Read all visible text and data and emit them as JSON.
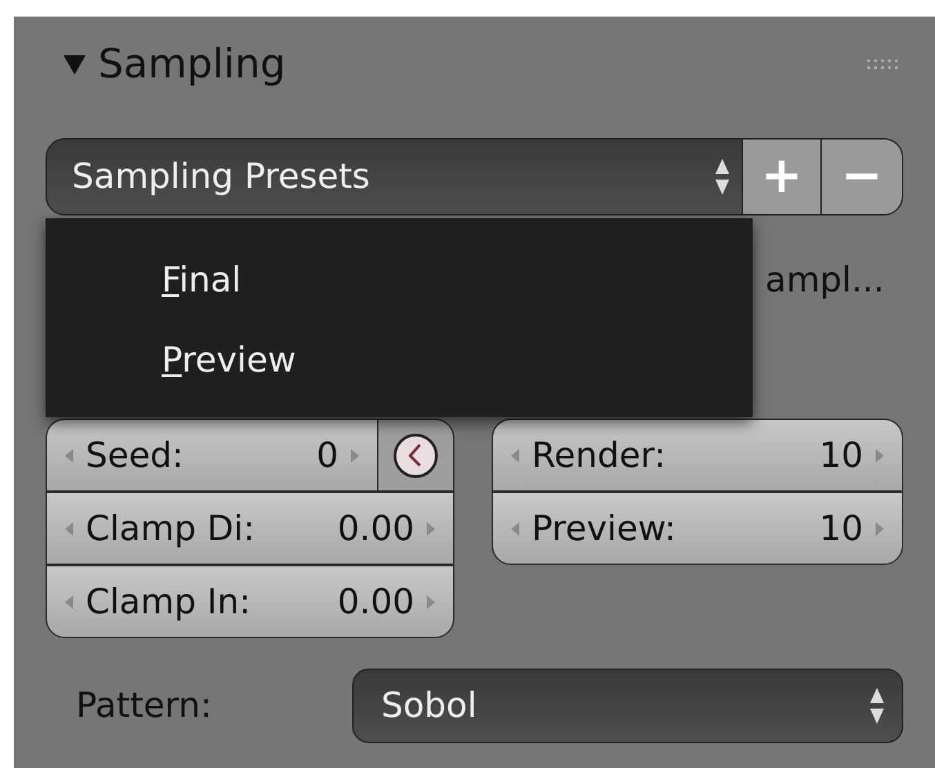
{
  "panel": {
    "title": "Sampling",
    "expanded": true
  },
  "presets": {
    "value": "Sampling Presets",
    "add_label": "+",
    "remove_label": "−"
  },
  "preset_menu": {
    "items": [
      {
        "label": "Final"
      },
      {
        "label": "Preview"
      }
    ]
  },
  "hidden_row": {
    "checkbox_label_visible": "ampl..."
  },
  "settings_fields": [
    {
      "label": "Seed:",
      "value": "0"
    },
    {
      "label": "Clamp Di:",
      "value": "0.00"
    },
    {
      "label": "Clamp In:",
      "value": "0.00"
    }
  ],
  "samples_fields": [
    {
      "label": "Render:",
      "value": "10"
    },
    {
      "label": "Preview:",
      "value": "10"
    }
  ],
  "pattern": {
    "label": "Pattern:",
    "value": "Sobol"
  }
}
